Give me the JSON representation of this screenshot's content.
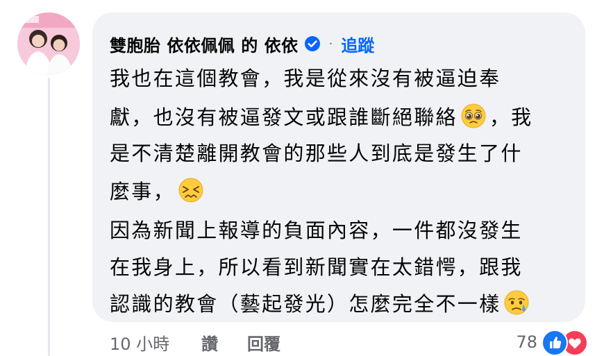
{
  "comment": {
    "author": "雙胞胎 依依佩佩  的 依依",
    "separator": "·",
    "follow_label": "追蹤",
    "lines": [
      {
        "text": "我也在這個教會，我是從來沒有被逼迫奉"
      },
      {
        "text": "獻，也沒有被逼發文或跟誰斷絕聯絡",
        "emoji": "pleading-face",
        "after": " ，我"
      },
      {
        "text": "是不清楚離開教會的那些人到底是發生了什"
      },
      {
        "text": "麼事，",
        "emoji": "persevering-face"
      },
      {
        "text": "因為新聞上報導的負面內容，一件都沒發生"
      },
      {
        "text": "在我身上，所以看到新聞實在太錯愕，跟我"
      },
      {
        "text": "認識的教會（藝起發光）怎麼完全不一樣",
        "emoji": "crying-face"
      }
    ]
  },
  "footer": {
    "time": "10 小時",
    "like_label": "讚",
    "reply_label": "回覆",
    "reaction_count": "78"
  },
  "colors": {
    "bubble": "#f0f2f5",
    "follow": "#0866ff",
    "muted": "#65676b",
    "like": "#1877f2",
    "love": "#f33e58"
  },
  "icons": {
    "verified": "verified-badge-icon",
    "like_reaction": "thumbs-up-icon",
    "love_reaction": "heart-icon"
  }
}
